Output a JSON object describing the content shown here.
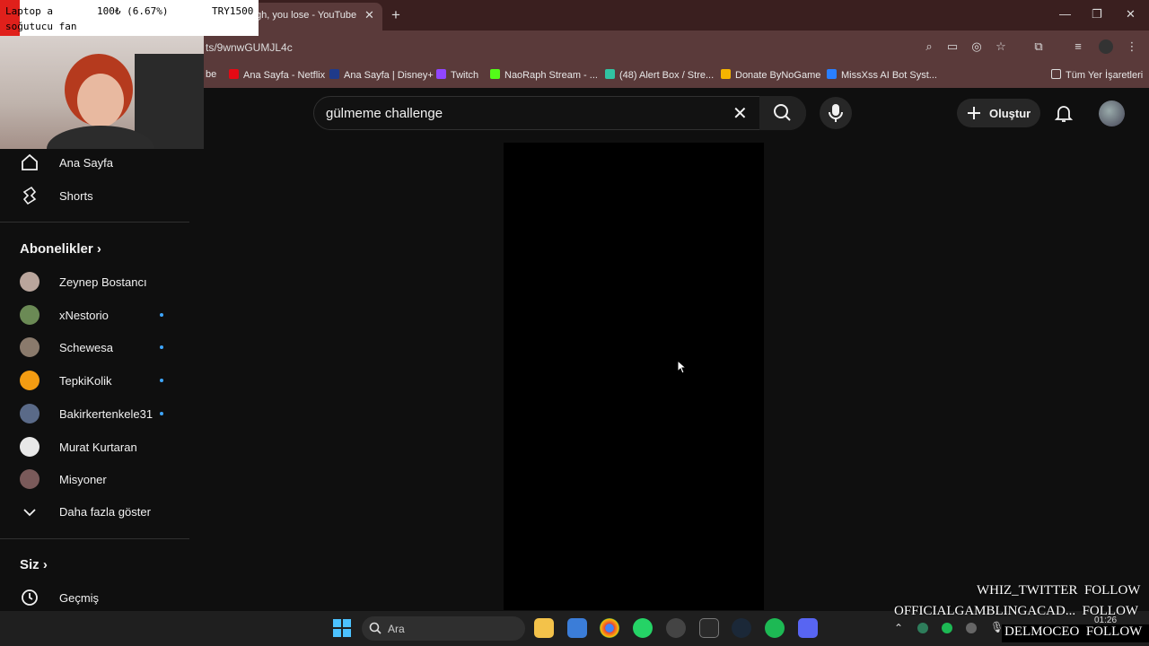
{
  "browser": {
    "tab_title": "gh, you lose - YouTube",
    "url": "ts/9wnwGUMJL4c",
    "bookmarks": [
      {
        "label": "be",
        "color": "#c00"
      },
      {
        "label": "Ana Sayfa - Netflix",
        "color": "#e50914"
      },
      {
        "label": "Ana Sayfa | Disney+",
        "color": "#1f3a8a"
      },
      {
        "label": "Twitch",
        "color": "#9146ff"
      },
      {
        "label": "NaoRaph Stream - ...",
        "color": "#53fc18"
      },
      {
        "label": "(48) Alert Box / Stre...",
        "color": "#31c3a2"
      },
      {
        "label": "Donate ByNoGame",
        "color": "#f5b400"
      },
      {
        "label": "MissXss AI Bot Syst...",
        "color": "#2a7fff"
      }
    ],
    "all_bookmarks": "Tüm Yer İşaretleri"
  },
  "header": {
    "search_value": "gülmeme challenge",
    "create_label": "Oluştur"
  },
  "sidebar": {
    "home": "Ana Sayfa",
    "shorts": "Shorts",
    "subscriptions_title": "Abonelikler",
    "channels": [
      {
        "name": "Zeynep Bostancı",
        "new": false,
        "color": "#b9a59c"
      },
      {
        "name": "xNestorio",
        "new": true,
        "color": "#6b8a55"
      },
      {
        "name": "Schewesa",
        "new": true,
        "color": "#8a7a6c"
      },
      {
        "name": "TepkiKolik",
        "new": true,
        "color": "#f39c12"
      },
      {
        "name": "Bakirkertenkele31",
        "new": true,
        "color": "#5a6a88"
      },
      {
        "name": "Murat Kurtaran",
        "new": false,
        "color": "#e8e8e8"
      },
      {
        "name": "Misyoner",
        "new": false,
        "color": "#7a5a5a"
      }
    ],
    "show_more": "Daha fazla göster",
    "you_title": "Siz",
    "history": "Geçmiş"
  },
  "overlay": {
    "donation_line1": "Laptop a",
    "donation_amount": "100₺ (6.67%)",
    "donation_goal": "TRY1500",
    "donation_line2": "soğutucu fan",
    "followers": [
      {
        "name": "WHIZ_TWITTER",
        "action": "FOLLOW"
      },
      {
        "name": "OFFICIALGAMBLINGACAD...",
        "action": "FOLLOW"
      },
      {
        "name": "DELMOCEO",
        "action": "FOLLOW"
      }
    ]
  },
  "taskbar": {
    "search_placeholder": "Ara",
    "clock": "01:26"
  }
}
